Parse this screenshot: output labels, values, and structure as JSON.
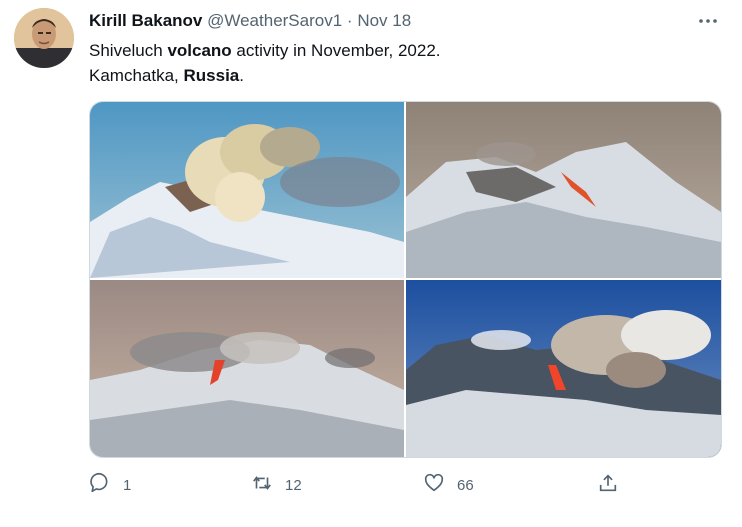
{
  "tweet": {
    "author_name": "Kirill Bakanov",
    "author_handle": "@WeatherSarov1",
    "separator": "·",
    "date": "Nov 18",
    "line1_a": "Shiveluch ",
    "line1_b": "volcano",
    "line1_c": " activity in November, 2022.",
    "line2_a": "Kamchatka, ",
    "line2_b": "Russia",
    "line2_c": "."
  },
  "actions": {
    "reply_count": "1",
    "retweet_count": "12",
    "like_count": "66"
  },
  "icons": [
    "more-icon",
    "reply-icon",
    "retweet-icon",
    "like-icon",
    "share-icon"
  ],
  "colors": {
    "text": "#0f1419",
    "muted": "#536471",
    "border": "#cfd9de"
  }
}
